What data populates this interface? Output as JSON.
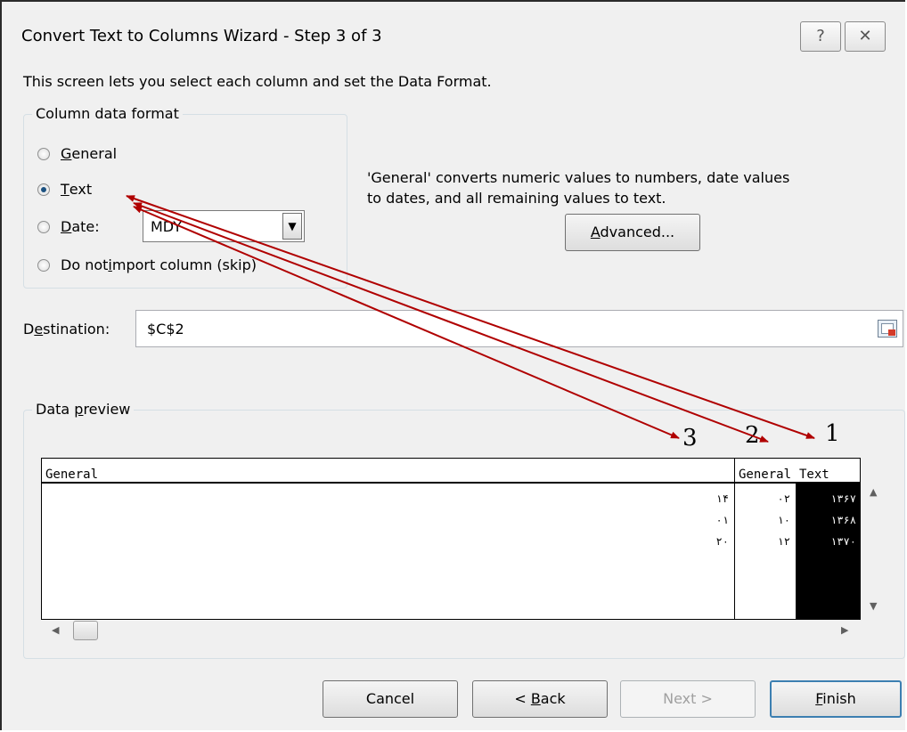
{
  "dialog": {
    "title": "Convert Text to Columns Wizard - Step 3 of 3",
    "help_button": "?",
    "close_button": "✕",
    "intro": "This screen lets you select each column and set the Data Format."
  },
  "column_data_format": {
    "legend": "Column data format",
    "options": [
      {
        "prefix": "",
        "accel": "G",
        "rest": "eneral",
        "selected": false
      },
      {
        "prefix": "",
        "accel": "T",
        "rest": "ext",
        "selected": true
      },
      {
        "prefix": "",
        "accel": "D",
        "rest": "ate:",
        "selected": false
      },
      {
        "prefix": "Do not ",
        "accel": "i",
        "rest": "mport column (skip)",
        "selected": false
      }
    ],
    "date_format": "MDY",
    "description_line1": "'General' converts numeric values to numbers, date values",
    "description_line2": "to dates, and all remaining values to text.",
    "advanced_accel": "A",
    "advanced_rest": "dvanced..."
  },
  "destination": {
    "label_pre": "D",
    "label_accel": "e",
    "label_rest": "stination:",
    "value": "$C$2"
  },
  "preview": {
    "legend_pre": "Data ",
    "legend_accel": "p",
    "legend_rest": "review",
    "columns": [
      {
        "header": "General",
        "cells": [
          "١۴",
          "٠١",
          "٢٠"
        ]
      },
      {
        "header": "General",
        "cells": [
          "٠٢",
          "١٠",
          "١٢"
        ]
      },
      {
        "header": "Text",
        "cells": [
          "١٣۶٧",
          "١٣۶٨",
          "١٣٧٠"
        ]
      }
    ]
  },
  "annotations": [
    "3",
    "2",
    "1"
  ],
  "colors": {
    "arrow": "#b00000",
    "selected_column_bg": "#000000"
  },
  "buttons": {
    "cancel": "Cancel",
    "back_pre": "< ",
    "back_accel": "B",
    "back_rest": "ack",
    "next": "Next >",
    "finish_accel": "F",
    "finish_rest": "inish"
  }
}
